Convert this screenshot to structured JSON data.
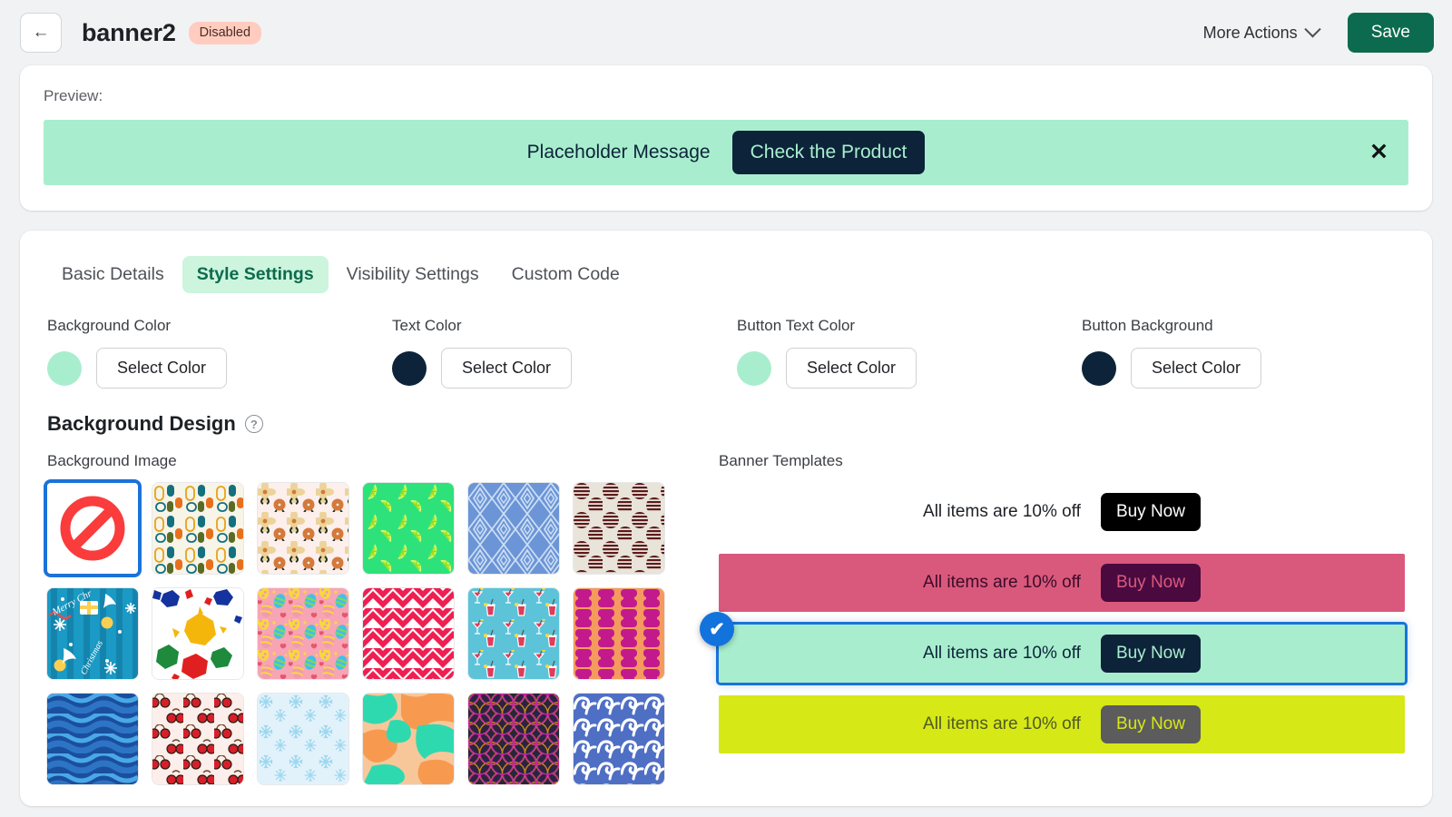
{
  "header": {
    "back_icon": "arrow-left-icon",
    "title": "banner2",
    "status": "Disabled",
    "more_actions_label": "More Actions",
    "chevron_icon": "chevron-down-icon",
    "save_label": "Save",
    "save_color": "#0c6b4e",
    "status_bg": "#ffccbf"
  },
  "preview": {
    "label": "Preview:",
    "message": "Placeholder Message",
    "cta_label": "Check the Product",
    "close_icon": "close-icon",
    "background_color": "#a8eece",
    "text_color": "#0d2339",
    "button_text_color": "#a8eece",
    "button_background_color": "#0d2339"
  },
  "tabs": [
    {
      "label": "Basic Details",
      "active": false
    },
    {
      "label": "Style Settings",
      "active": true
    },
    {
      "label": "Visibility Settings",
      "active": false
    },
    {
      "label": "Custom Code",
      "active": false
    }
  ],
  "colors": [
    {
      "label": "Background Color",
      "value": "#a8eece",
      "button": "Select Color"
    },
    {
      "label": "Text Color",
      "value": "#0d2339",
      "button": "Select Color"
    },
    {
      "label": "Button Text Color",
      "value": "#a8eece",
      "button": "Select Color"
    },
    {
      "label": "Button Background",
      "value": "#0d2339",
      "button": "Select Color"
    }
  ],
  "background_design": {
    "title": "Background Design",
    "help_icon": "help-circle-icon",
    "help_glyph": "?",
    "image_label": "Background Image",
    "selected_index": 0,
    "swatches": [
      {
        "name": "no-image",
        "pattern": "none-prohibited"
      },
      {
        "name": "abstract-shapes",
        "pattern": "abstract-capsules"
      },
      {
        "name": "retro-flowers",
        "pattern": "flowers"
      },
      {
        "name": "lime-slices",
        "pattern": "limes"
      },
      {
        "name": "blue-diamonds",
        "pattern": "diamonds"
      },
      {
        "name": "striped-circles",
        "pattern": "striped-dots"
      },
      {
        "name": "merry-christmas",
        "pattern": "christmas"
      },
      {
        "name": "paint-splatter",
        "pattern": "splatter"
      },
      {
        "name": "easter-eggs",
        "pattern": "easter"
      },
      {
        "name": "pink-chevron",
        "pattern": "chevron"
      },
      {
        "name": "cocktails",
        "pattern": "cocktails"
      },
      {
        "name": "magenta-blocks",
        "pattern": "blocks"
      },
      {
        "name": "blue-waves",
        "pattern": "wavy-stripes"
      },
      {
        "name": "cherries",
        "pattern": "cherries"
      },
      {
        "name": "snowflakes",
        "pattern": "snowflakes"
      },
      {
        "name": "camouflage",
        "pattern": "camo"
      },
      {
        "name": "art-deco-scales",
        "pattern": "scales"
      },
      {
        "name": "ocean-waves",
        "pattern": "ocean-waves"
      }
    ]
  },
  "banner_templates": {
    "label": "Banner Templates",
    "selected_index": 2,
    "items": [
      {
        "message": "All items are 10% off",
        "button_label": "Buy Now",
        "background": "transparent",
        "text_color": "#1d2125",
        "button_bg": "#000000",
        "button_text": "#ffffff",
        "selected": false
      },
      {
        "message": "All items are 10% off",
        "button_label": "Buy Now",
        "background": "#d9597c",
        "text_color": "#3d0b28",
        "button_bg": "#4a0a3f",
        "button_text": "#d9597c",
        "selected": false
      },
      {
        "message": "All items are 10% off",
        "button_label": "Buy Now",
        "background": "#a8eece",
        "text_color": "#0d2339",
        "button_bg": "#0d2339",
        "button_text": "#a8eece",
        "selected": true
      },
      {
        "message": "All items are 10% off",
        "button_label": "Buy Now",
        "background": "#d7e817",
        "text_color": "#4f5a22",
        "button_bg": "#5c5c5c",
        "button_text": "#d7e817",
        "selected": false
      }
    ],
    "check_icon": "check-circle-icon",
    "check_glyph": "✔"
  }
}
